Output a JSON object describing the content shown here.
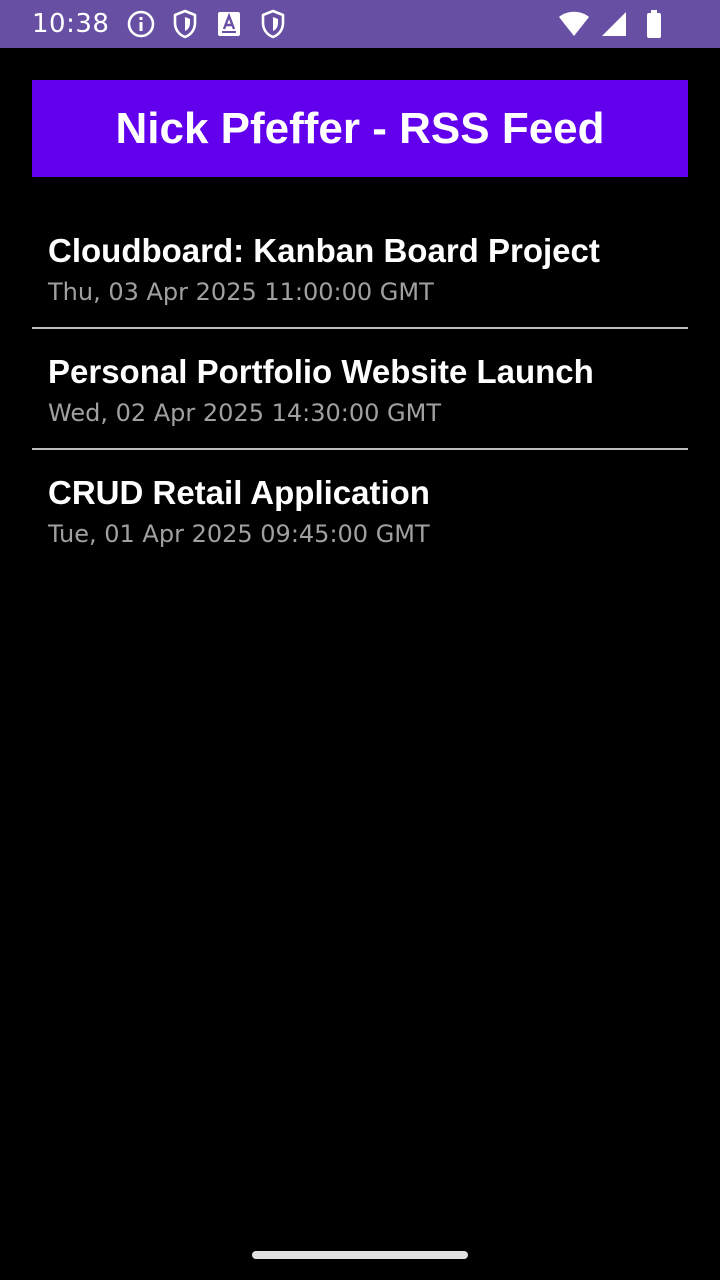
{
  "status_bar": {
    "time": "10:38",
    "left_icons": [
      "info-icon",
      "shield-icon",
      "text-a-icon",
      "shield-icon"
    ],
    "right_icons": [
      "wifi-icon",
      "signal-icon",
      "battery-icon"
    ],
    "color": "#6750a4"
  },
  "header": {
    "title": "Nick Pfeffer - RSS Feed",
    "color": "#6200ee"
  },
  "feed": {
    "items": [
      {
        "title": "Cloudboard: Kanban Board Project",
        "date": "Thu, 03 Apr 2025 11:00:00 GMT"
      },
      {
        "title": "Personal Portfolio Website Launch",
        "date": "Wed, 02 Apr 2025 14:30:00 GMT"
      },
      {
        "title": "CRUD Retail Application",
        "date": "Tue, 01 Apr 2025 09:45:00 GMT"
      }
    ]
  },
  "colors": {
    "background": "#000000",
    "date_text": "#a0a0a0",
    "divider": "#bdbdbd"
  }
}
